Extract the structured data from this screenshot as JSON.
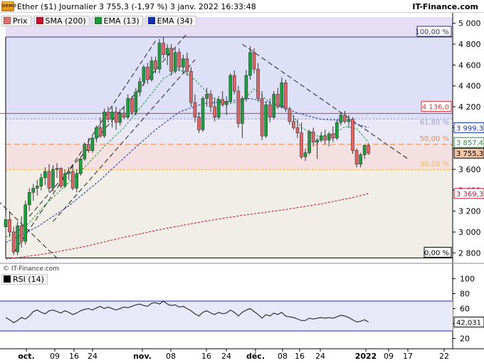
{
  "header": {
    "badge": "DEMO",
    "title": "Ether ($1) Journalier 3 755,3 (-1,97 %) 3 janv. 2022 16:33:48",
    "brand": "IT-Finance.com"
  },
  "legend": {
    "items": [
      {
        "label": "Prix",
        "color": "#e07070"
      },
      {
        "label": "SMA (200)",
        "color": "#c8102e"
      },
      {
        "label": "EMA (13)",
        "color": "#1f9a3a"
      },
      {
        "label": "EMA (34)",
        "color": "#1630b8"
      }
    ]
  },
  "rsi_legend": {
    "label": "RSI (14)",
    "color": "#000000"
  },
  "copyright": "© IT-Finance.com",
  "colors": {
    "up": "#1e9e3c",
    "down": "#e06666",
    "sma200": "#c8102e",
    "ema13": "#1f9a3a",
    "ema34": "#1630b8",
    "fib_top": "#e6def5",
    "fib_mid": "#dde0f6",
    "fib_low": "#f4e0e0",
    "fib_base": "#f0eee6"
  },
  "chart_data": [
    {
      "type": "candlestick",
      "title": "Ether ($1) Journalier",
      "ylim": [
        2700,
        5100
      ],
      "y_ticks": [
        "5 000",
        "4 800",
        "4 600",
        "4 400",
        "4 200",
        "4 000",
        "3 800",
        "3 600",
        "3 400",
        "3 200",
        "3 000",
        "2 800"
      ],
      "x_ticks": [
        "oct.",
        "09",
        "16",
        "24",
        "nov.",
        "08",
        "16",
        "24",
        "déc.",
        "08",
        "16",
        "24",
        "2022",
        "09",
        "17",
        "22"
      ],
      "fibonacci": [
        {
          "label": "100,00 %",
          "value": 4868
        },
        {
          "label": "61,80 %",
          "value": 4083
        },
        {
          "label": "50,00 %",
          "value": 3840
        },
        {
          "label": "38,20 %",
          "value": 3597
        },
        {
          "label": "0,00 %",
          "value": 2752
        }
      ],
      "horizontal_lines": [
        {
          "label": "4 136,0",
          "value": 4136
        }
      ],
      "price_labels": [
        {
          "label": "3 999,3",
          "value": 3999.3,
          "series": "EMA (34)"
        },
        {
          "label": "3 857,4",
          "value": 3857.4,
          "series": "EMA (13)"
        },
        {
          "label": "3 755,3",
          "value": 3755.3,
          "series": "Prix"
        },
        {
          "label": "3 369,3",
          "value": 3369.3,
          "series": "SMA (200)"
        }
      ],
      "candles": [
        {
          "o": 3050,
          "h": 3160,
          "l": 2900,
          "c": 3120
        },
        {
          "o": 3120,
          "h": 3200,
          "l": 2950,
          "c": 3000
        },
        {
          "o": 3000,
          "h": 3050,
          "l": 2780,
          "c": 2810
        },
        {
          "o": 2810,
          "h": 3100,
          "l": 2780,
          "c": 3060
        },
        {
          "o": 3060,
          "h": 3150,
          "l": 2850,
          "c": 2910
        },
        {
          "o": 2910,
          "h": 3300,
          "l": 2880,
          "c": 3260
        },
        {
          "o": 3260,
          "h": 3420,
          "l": 3200,
          "c": 3380
        },
        {
          "o": 3380,
          "h": 3460,
          "l": 3300,
          "c": 3420
        },
        {
          "o": 3420,
          "h": 3500,
          "l": 3350,
          "c": 3440
        },
        {
          "o": 3440,
          "h": 3560,
          "l": 3400,
          "c": 3520
        },
        {
          "o": 3520,
          "h": 3620,
          "l": 3450,
          "c": 3580
        },
        {
          "o": 3580,
          "h": 3650,
          "l": 3380,
          "c": 3420
        },
        {
          "o": 3420,
          "h": 3640,
          "l": 3390,
          "c": 3600
        },
        {
          "o": 3600,
          "h": 3660,
          "l": 3520,
          "c": 3610
        },
        {
          "o": 3610,
          "h": 3620,
          "l": 3420,
          "c": 3440
        },
        {
          "o": 3440,
          "h": 3600,
          "l": 3420,
          "c": 3560
        },
        {
          "o": 3560,
          "h": 3620,
          "l": 3500,
          "c": 3580
        },
        {
          "o": 3580,
          "h": 3640,
          "l": 3400,
          "c": 3420
        },
        {
          "o": 3420,
          "h": 3600,
          "l": 3380,
          "c": 3560
        },
        {
          "o": 3560,
          "h": 3720,
          "l": 3540,
          "c": 3700
        },
        {
          "o": 3700,
          "h": 3860,
          "l": 3680,
          "c": 3840
        },
        {
          "o": 3840,
          "h": 3900,
          "l": 3760,
          "c": 3780
        },
        {
          "o": 3780,
          "h": 3920,
          "l": 3760,
          "c": 3900
        },
        {
          "o": 3900,
          "h": 4020,
          "l": 3860,
          "c": 4000
        },
        {
          "o": 4000,
          "h": 4100,
          "l": 3900,
          "c": 3920
        },
        {
          "o": 3920,
          "h": 4180,
          "l": 3900,
          "c": 4150
        },
        {
          "o": 4150,
          "h": 4200,
          "l": 4050,
          "c": 4080
        },
        {
          "o": 4080,
          "h": 4200,
          "l": 4000,
          "c": 4150
        },
        {
          "o": 4150,
          "h": 4200,
          "l": 3980,
          "c": 4050
        },
        {
          "o": 4050,
          "h": 4180,
          "l": 4020,
          "c": 4140
        },
        {
          "o": 4140,
          "h": 4200,
          "l": 4080,
          "c": 4100
        },
        {
          "o": 4100,
          "h": 4320,
          "l": 4080,
          "c": 4280
        },
        {
          "o": 4280,
          "h": 4300,
          "l": 4120,
          "c": 4150
        },
        {
          "o": 4150,
          "h": 4380,
          "l": 4120,
          "c": 4340
        },
        {
          "o": 4340,
          "h": 4480,
          "l": 4300,
          "c": 4440
        },
        {
          "o": 4440,
          "h": 4600,
          "l": 4400,
          "c": 4580
        },
        {
          "o": 4580,
          "h": 4620,
          "l": 4420,
          "c": 4460
        },
        {
          "o": 4460,
          "h": 4680,
          "l": 4440,
          "c": 4640
        },
        {
          "o": 4640,
          "h": 4680,
          "l": 4520,
          "c": 4560
        },
        {
          "o": 4560,
          "h": 4850,
          "l": 4520,
          "c": 4810
        },
        {
          "o": 4810,
          "h": 4870,
          "l": 4660,
          "c": 4700
        },
        {
          "o": 4700,
          "h": 4800,
          "l": 4600,
          "c": 4760
        },
        {
          "o": 4760,
          "h": 4800,
          "l": 4500,
          "c": 4540
        },
        {
          "o": 4540,
          "h": 4760,
          "l": 4520,
          "c": 4720
        },
        {
          "o": 4720,
          "h": 4760,
          "l": 4540,
          "c": 4580
        },
        {
          "o": 4580,
          "h": 4700,
          "l": 4520,
          "c": 4660
        },
        {
          "o": 4660,
          "h": 4720,
          "l": 4500,
          "c": 4540
        },
        {
          "o": 4540,
          "h": 4580,
          "l": 4200,
          "c": 4240
        },
        {
          "o": 4240,
          "h": 4320,
          "l": 4050,
          "c": 4100
        },
        {
          "o": 4100,
          "h": 4150,
          "l": 3950,
          "c": 3980
        },
        {
          "o": 3980,
          "h": 4300,
          "l": 3960,
          "c": 4280
        },
        {
          "o": 4280,
          "h": 4380,
          "l": 4200,
          "c": 4320
        },
        {
          "o": 4320,
          "h": 4360,
          "l": 4150,
          "c": 4200
        },
        {
          "o": 4200,
          "h": 4280,
          "l": 4060,
          "c": 4100
        },
        {
          "o": 4100,
          "h": 4300,
          "l": 4080,
          "c": 4270
        },
        {
          "o": 4270,
          "h": 4350,
          "l": 4200,
          "c": 4220
        },
        {
          "o": 4220,
          "h": 4300,
          "l": 4120,
          "c": 4250
        },
        {
          "o": 4250,
          "h": 4520,
          "l": 4230,
          "c": 4500
        },
        {
          "o": 4500,
          "h": 4550,
          "l": 4320,
          "c": 4350
        },
        {
          "o": 4350,
          "h": 4400,
          "l": 4000,
          "c": 4040
        },
        {
          "o": 4040,
          "h": 4300,
          "l": 3900,
          "c": 4280
        },
        {
          "o": 4280,
          "h": 4550,
          "l": 4250,
          "c": 4500
        },
        {
          "o": 4500,
          "h": 4780,
          "l": 4460,
          "c": 4720
        },
        {
          "o": 4720,
          "h": 4760,
          "l": 4520,
          "c": 4560
        },
        {
          "o": 4560,
          "h": 4620,
          "l": 4250,
          "c": 4280
        },
        {
          "o": 4280,
          "h": 4350,
          "l": 3880,
          "c": 3920
        },
        {
          "o": 3920,
          "h": 4250,
          "l": 3900,
          "c": 4220
        },
        {
          "o": 4220,
          "h": 4280,
          "l": 4050,
          "c": 4100
        },
        {
          "o": 4100,
          "h": 4350,
          "l": 4080,
          "c": 4320
        },
        {
          "o": 4320,
          "h": 4380,
          "l": 4180,
          "c": 4200
        },
        {
          "o": 4200,
          "h": 4480,
          "l": 4180,
          "c": 4430
        },
        {
          "o": 4430,
          "h": 4460,
          "l": 4150,
          "c": 4180
        },
        {
          "o": 4180,
          "h": 4200,
          "l": 4030,
          "c": 4060
        },
        {
          "o": 4060,
          "h": 4120,
          "l": 3980,
          "c": 4000
        },
        {
          "o": 4000,
          "h": 4080,
          "l": 3900,
          "c": 3950
        },
        {
          "o": 3950,
          "h": 4050,
          "l": 3700,
          "c": 3720
        },
        {
          "o": 3720,
          "h": 3800,
          "l": 3680,
          "c": 3760
        },
        {
          "o": 3760,
          "h": 3980,
          "l": 3740,
          "c": 3960
        },
        {
          "o": 3960,
          "h": 4000,
          "l": 3820,
          "c": 3860
        },
        {
          "o": 3860,
          "h": 3900,
          "l": 3700,
          "c": 3880
        },
        {
          "o": 3880,
          "h": 3960,
          "l": 3860,
          "c": 3920
        },
        {
          "o": 3920,
          "h": 3980,
          "l": 3840,
          "c": 3880
        },
        {
          "o": 3880,
          "h": 3960,
          "l": 3820,
          "c": 3940
        },
        {
          "o": 3940,
          "h": 4010,
          "l": 3860,
          "c": 3900
        },
        {
          "o": 3900,
          "h": 4080,
          "l": 3880,
          "c": 4050
        },
        {
          "o": 4050,
          "h": 4150,
          "l": 4020,
          "c": 4120
        },
        {
          "o": 4120,
          "h": 4160,
          "l": 4040,
          "c": 4060
        },
        {
          "o": 4060,
          "h": 4120,
          "l": 4000,
          "c": 4080
        },
        {
          "o": 4080,
          "h": 4100,
          "l": 3750,
          "c": 3780
        },
        {
          "o": 3780,
          "h": 3800,
          "l": 3620,
          "c": 3650
        },
        {
          "o": 3650,
          "h": 3760,
          "l": 3620,
          "c": 3740
        },
        {
          "o": 3740,
          "h": 3840,
          "l": 3700,
          "c": 3830
        },
        {
          "o": 3830,
          "h": 3850,
          "l": 3740,
          "c": 3755.3
        }
      ],
      "sma200": [
        {
          "i": 0,
          "v": 2740
        },
        {
          "i": 10,
          "v": 2790
        },
        {
          "i": 20,
          "v": 2860
        },
        {
          "i": 30,
          "v": 2950
        },
        {
          "i": 40,
          "v": 3030
        },
        {
          "i": 50,
          "v": 3100
        },
        {
          "i": 60,
          "v": 3160
        },
        {
          "i": 70,
          "v": 3210
        },
        {
          "i": 80,
          "v": 3270
        },
        {
          "i": 88,
          "v": 3330
        },
        {
          "i": 92,
          "v": 3369.3
        }
      ],
      "ema13": [
        {
          "i": 0,
          "v": 2950
        },
        {
          "i": 5,
          "v": 3050
        },
        {
          "i": 10,
          "v": 3260
        },
        {
          "i": 15,
          "v": 3440
        },
        {
          "i": 20,
          "v": 3620
        },
        {
          "i": 25,
          "v": 3820
        },
        {
          "i": 30,
          "v": 4000
        },
        {
          "i": 35,
          "v": 4230
        },
        {
          "i": 40,
          "v": 4470
        },
        {
          "i": 44,
          "v": 4560
        },
        {
          "i": 48,
          "v": 4460
        },
        {
          "i": 52,
          "v": 4300
        },
        {
          "i": 56,
          "v": 4230
        },
        {
          "i": 60,
          "v": 4250
        },
        {
          "i": 63,
          "v": 4370
        },
        {
          "i": 67,
          "v": 4240
        },
        {
          "i": 71,
          "v": 4200
        },
        {
          "i": 75,
          "v": 4000
        },
        {
          "i": 79,
          "v": 3920
        },
        {
          "i": 83,
          "v": 3930
        },
        {
          "i": 86,
          "v": 4010
        },
        {
          "i": 89,
          "v": 3990
        },
        {
          "i": 92,
          "v": 3857.4
        }
      ],
      "ema34": [
        {
          "i": 0,
          "v": 2900
        },
        {
          "i": 8,
          "v": 3050
        },
        {
          "i": 16,
          "v": 3250
        },
        {
          "i": 24,
          "v": 3500
        },
        {
          "i": 32,
          "v": 3780
        },
        {
          "i": 38,
          "v": 3980
        },
        {
          "i": 44,
          "v": 4150
        },
        {
          "i": 50,
          "v": 4230
        },
        {
          "i": 56,
          "v": 4250
        },
        {
          "i": 62,
          "v": 4280
        },
        {
          "i": 68,
          "v": 4230
        },
        {
          "i": 74,
          "v": 4140
        },
        {
          "i": 80,
          "v": 4080
        },
        {
          "i": 86,
          "v": 4070
        },
        {
          "i": 92,
          "v": 3999.3
        }
      ],
      "trendlines": [
        {
          "x1": -2,
          "y1": 3300,
          "x2": 13,
          "y2": 2750
        },
        {
          "x1": 2,
          "y1": 2800,
          "x2": 38,
          "y2": 4830
        },
        {
          "x1": 6,
          "y1": 3150,
          "x2": 46,
          "y2": 4900
        },
        {
          "x1": 12,
          "y1": 3100,
          "x2": 48,
          "y2": 4650
        },
        {
          "x1": 60,
          "y1": 4800,
          "x2": 102,
          "y2": 3700
        }
      ]
    },
    {
      "type": "line",
      "title": "RSI (14)",
      "ylim": [
        10,
        110
      ],
      "y_ticks": [
        "100",
        "80",
        "60",
        "40",
        "20"
      ],
      "levels": [
        70,
        30
      ],
      "last_label": "42,031",
      "values": [
        48,
        45,
        41,
        44,
        48,
        46,
        50,
        56,
        58,
        55,
        53,
        57,
        58,
        56,
        54,
        57,
        55,
        52,
        54,
        57,
        59,
        60,
        58,
        61,
        63,
        60,
        62,
        60,
        58,
        60,
        62,
        61,
        63,
        65,
        66,
        64,
        63,
        67,
        68,
        66,
        70,
        66,
        64,
        65,
        62,
        63,
        60,
        57,
        53,
        50,
        55,
        57,
        54,
        52,
        55,
        53,
        54,
        58,
        55,
        50,
        55,
        58,
        60,
        56,
        52,
        47,
        52,
        50,
        54,
        52,
        55,
        50,
        49,
        48,
        46,
        44,
        44,
        47,
        46,
        47,
        48,
        47,
        48,
        47,
        49,
        51,
        50,
        48,
        45,
        42,
        43,
        45,
        42
      ]
    }
  ]
}
